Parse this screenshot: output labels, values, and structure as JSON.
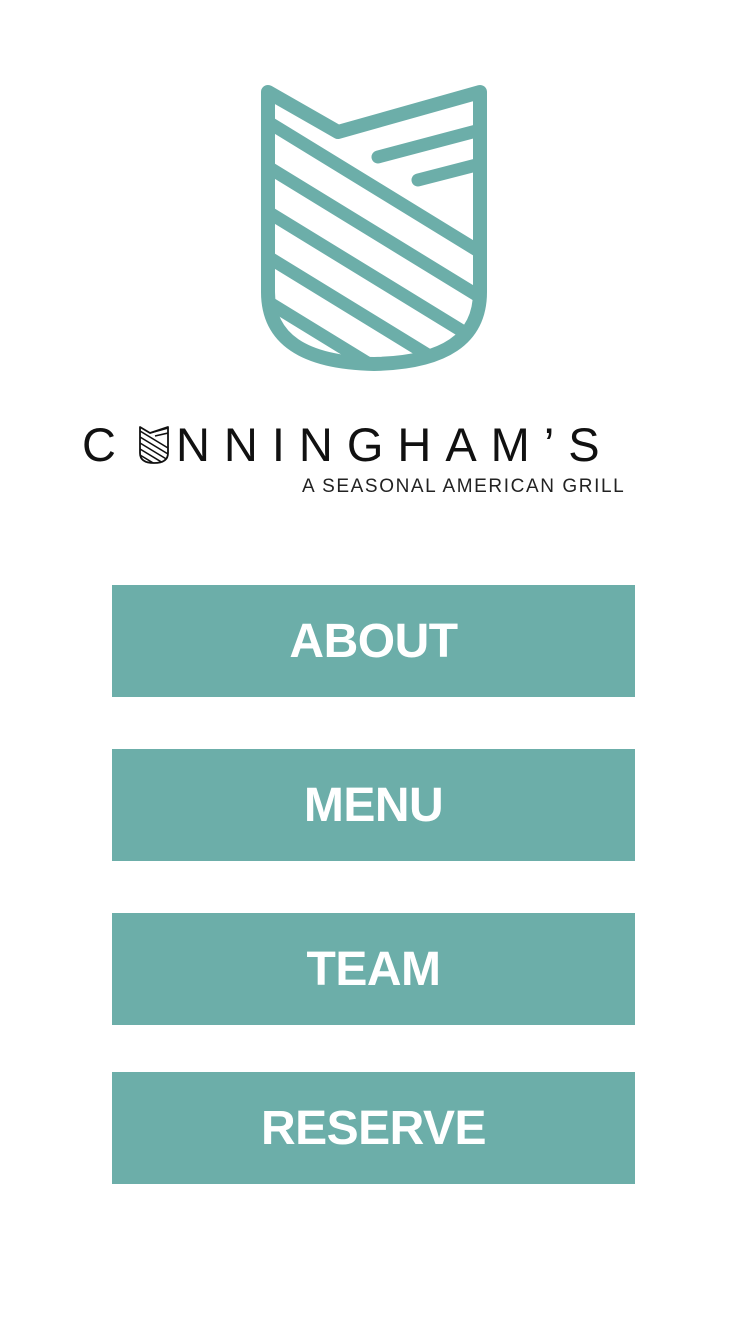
{
  "brand": {
    "name_prefix": "C",
    "name_rest": "NNINGHAM’S",
    "tagline": "A SEASONAL AMERICAN GRILL",
    "accent_color": "#6caea9",
    "logo_icon": "striped-shield-icon"
  },
  "nav": {
    "about_label": "ABOUT",
    "menu_label": "MENU",
    "team_label": "TEAM",
    "reserve_label": "RESERVE"
  }
}
